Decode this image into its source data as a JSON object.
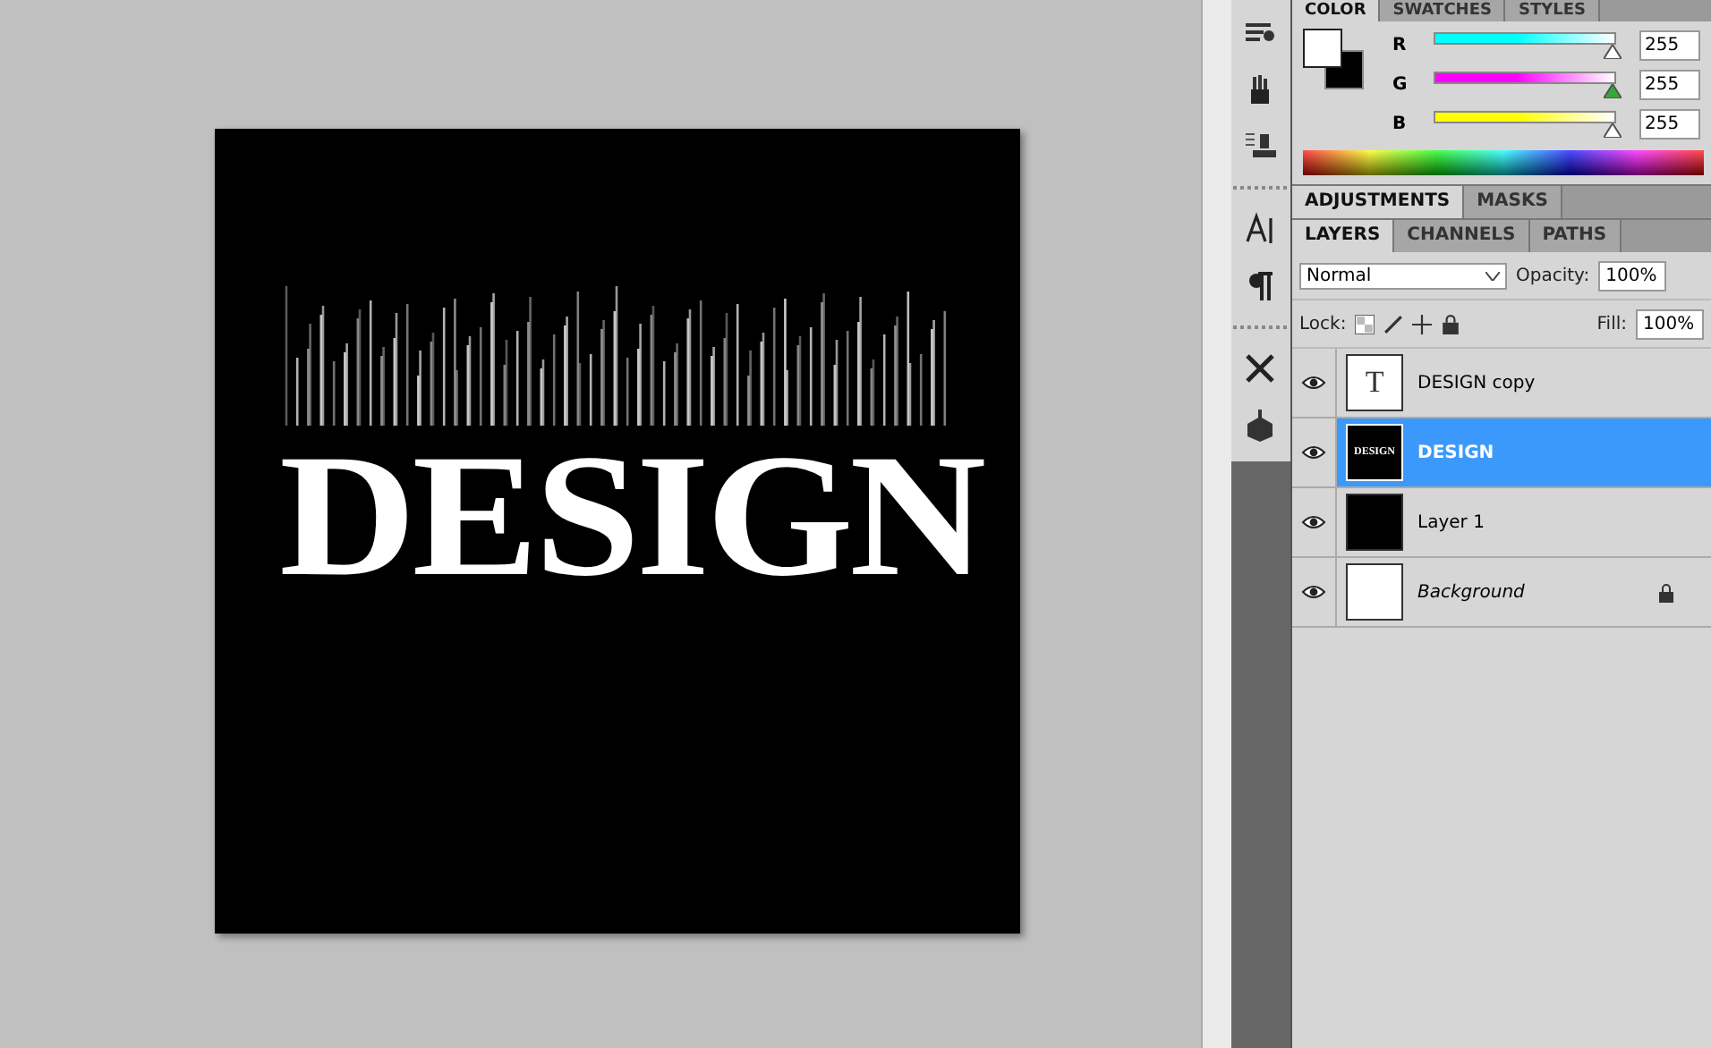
{
  "canvas": {
    "text": "DESIGN"
  },
  "tools": [
    {
      "kind": "brush-presets"
    },
    {
      "kind": "clone-source"
    },
    {
      "kind": "stamp"
    },
    {
      "kind": "type"
    },
    {
      "kind": "paragraph"
    },
    {
      "kind": "tools"
    },
    {
      "kind": "object"
    }
  ],
  "color_panel": {
    "tabs": [
      {
        "label": "COLOR",
        "selected": true
      },
      {
        "label": "SWATCHES",
        "selected": false
      },
      {
        "label": "STYLES",
        "selected": false
      }
    ],
    "channels": [
      {
        "name": "R",
        "color": "#00ffff",
        "level": 1,
        "value": "255"
      },
      {
        "name": "G",
        "color": "#ff00ff",
        "level": 1,
        "value": "255"
      },
      {
        "name": "B",
        "color": "#ffff00",
        "level": 1,
        "value": "255"
      }
    ]
  },
  "adjust_panel": {
    "tabs": [
      {
        "label": "ADJUSTMENTS",
        "selected": true
      },
      {
        "label": "MASKS",
        "selected": false
      }
    ]
  },
  "layers_panel": {
    "tabs": [
      {
        "label": "LAYERS",
        "selected": true
      },
      {
        "label": "CHANNELS",
        "selected": false
      },
      {
        "label": "PATHS",
        "selected": false
      }
    ],
    "blend_mode": "Normal",
    "opacity_label": "Opacity:",
    "opacity": "100%",
    "lock_label": "Lock:",
    "fill_label": "Fill:",
    "fill": "100%",
    "layers": [
      {
        "name": "DESIGN copy",
        "kind": "text",
        "thumb_text": "T",
        "visible": true,
        "selected": false,
        "locked": false,
        "italic": false
      },
      {
        "name": "DESIGN",
        "kind": "design",
        "thumb_text": "DESIGN",
        "visible": true,
        "selected": true,
        "locked": false,
        "italic": false
      },
      {
        "name": "Layer 1",
        "kind": "black",
        "visible": true,
        "selected": false,
        "locked": false,
        "italic": false
      },
      {
        "name": "Background",
        "kind": "white",
        "visible": true,
        "selected": false,
        "locked": true,
        "italic": true
      }
    ]
  }
}
